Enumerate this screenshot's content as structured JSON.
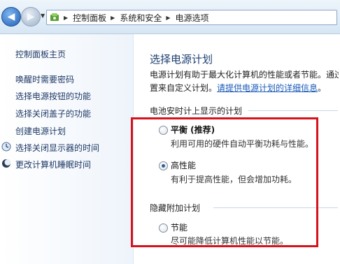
{
  "address_bar": {
    "crumbs": [
      "控制面板",
      "系统和安全",
      "电源选项"
    ]
  },
  "left_pane": {
    "home": "控制面板主页",
    "links": [
      "唤醒时需要密码",
      "选择电源按钮的功能",
      "选择关闭盖子的功能",
      "创建电源计划",
      "选择关闭显示器的时间",
      "更改计算机睡眠时间"
    ]
  },
  "main": {
    "title": "选择电源计划",
    "description_line1": "电源计划有助于最大化计算机的性能或者节能。通过",
    "description_line2_prefix": "置来自定义计划。",
    "description_link": "请提供电源计划的详细信息",
    "section_battery": "电池安时计上显示的计划",
    "section_hidden": "隐藏附加计划",
    "plans": [
      {
        "name": "平衡 (推荐)",
        "desc": "利用可用的硬件自动平衡功耗与性能。",
        "selected": false
      },
      {
        "name": "高性能",
        "desc": "有利于提高性能，但会增加功耗。",
        "selected": true
      },
      {
        "name": "节能",
        "desc": "尽可能降低计算机性能以节能。",
        "selected": false
      }
    ]
  },
  "colors": {
    "highlight_border": "#d6121d",
    "link": "#1a5bb8",
    "title": "#1d3f6f"
  }
}
